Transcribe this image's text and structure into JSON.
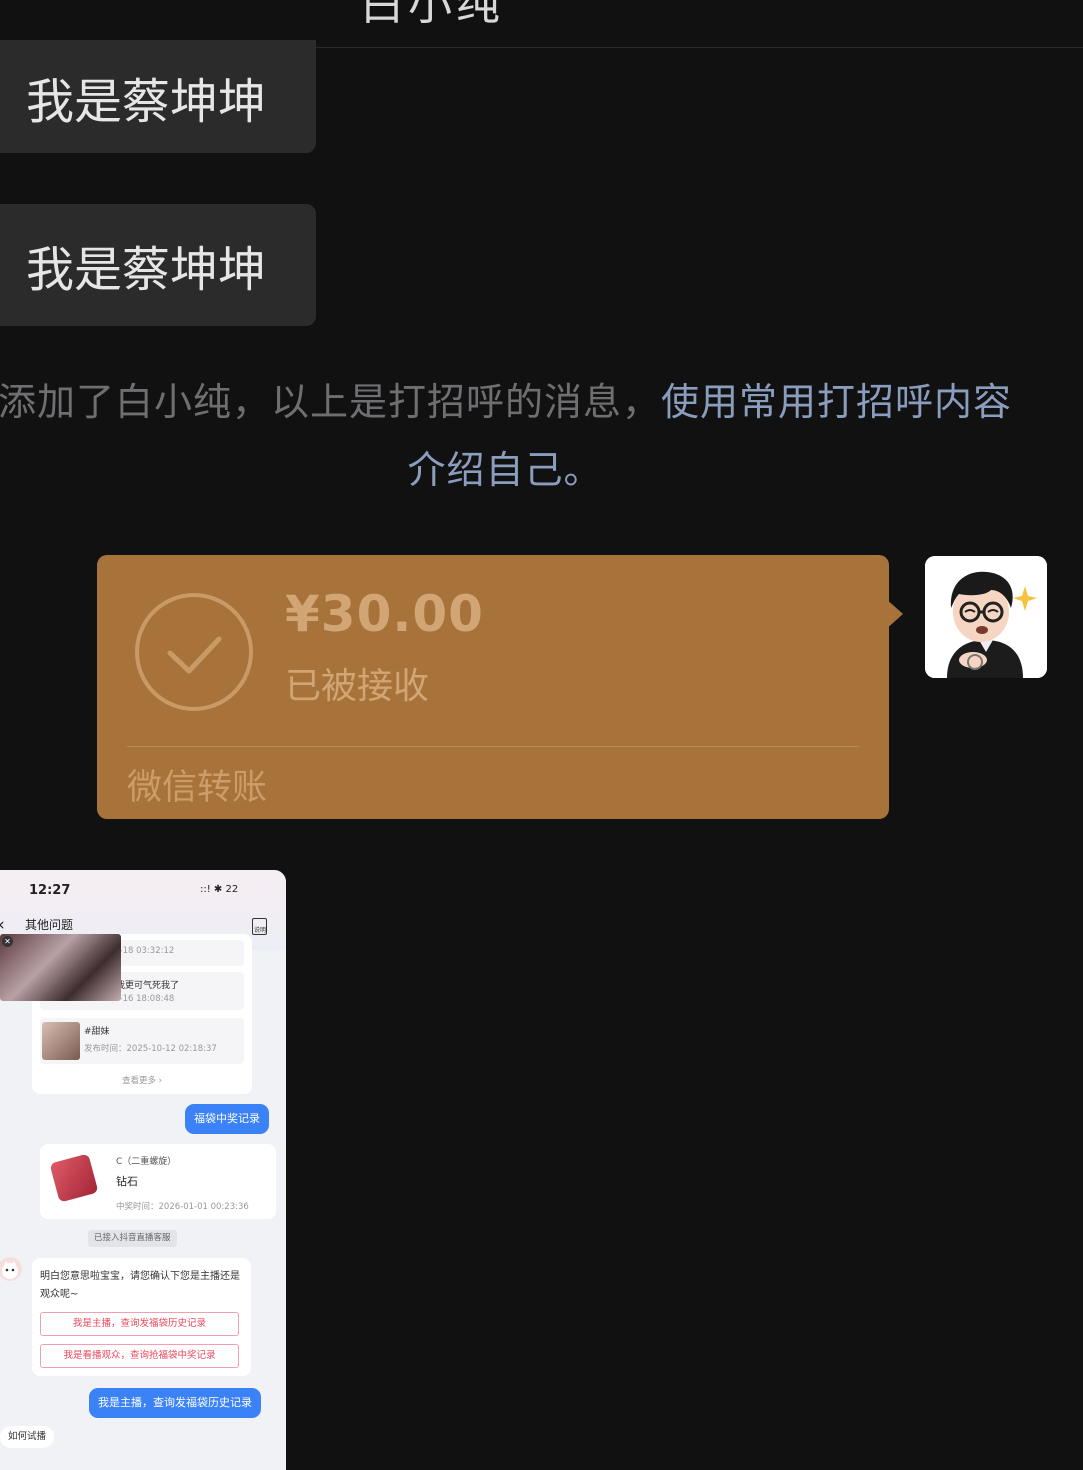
{
  "header": {
    "title_fragment": "白小纯"
  },
  "messages": {
    "incoming": [
      "我是蔡坤坤",
      "我是蔡坤坤"
    ],
    "system": {
      "plain": "添加了白小纯，以上是打招呼的消息，",
      "link": "使用常用打招呼内容介绍自己。"
    }
  },
  "transfer": {
    "amount": "¥30.00",
    "status": "已被接收",
    "type": "微信转账",
    "color": "#a8733a"
  },
  "avatar": {
    "icon": "cartoon-avatar-icon"
  },
  "screenshot": {
    "time": "12:27",
    "status_icons": "::! ✱ 22",
    "back_icon": "chevron-left-icon",
    "title": "其他问题",
    "note_icon": "note-icon",
    "note_label": "说明",
    "card1": {
      "rows": [
        {
          "title": "",
          "time": "2025-10-18 03:32:12"
        },
        {
          "title": "么可能比我更可气死我了",
          "time": "2025-10-16 18:08:48"
        },
        {
          "title": "#甜妹",
          "time": "发布时间：2025-10-12 02:18:37"
        }
      ],
      "more": "查看更多 ›"
    },
    "pill1": "福袋中奖记录",
    "card2": {
      "user": "C（二重螺旋）",
      "name": "钻石",
      "time": "中奖时间：2026-01-01 00:23:36"
    },
    "connected": "已接入抖音直播客服",
    "card3": {
      "text": "明白您意思啦宝宝，请您确认下您是主播还是观众呢~",
      "options": [
        "我是主播，查询发福袋历史记录",
        "我是看播观众，查询抢福袋中奖记录"
      ]
    },
    "pill2": "我是主播，查询发福袋历史记录",
    "hint": "如何试播"
  }
}
